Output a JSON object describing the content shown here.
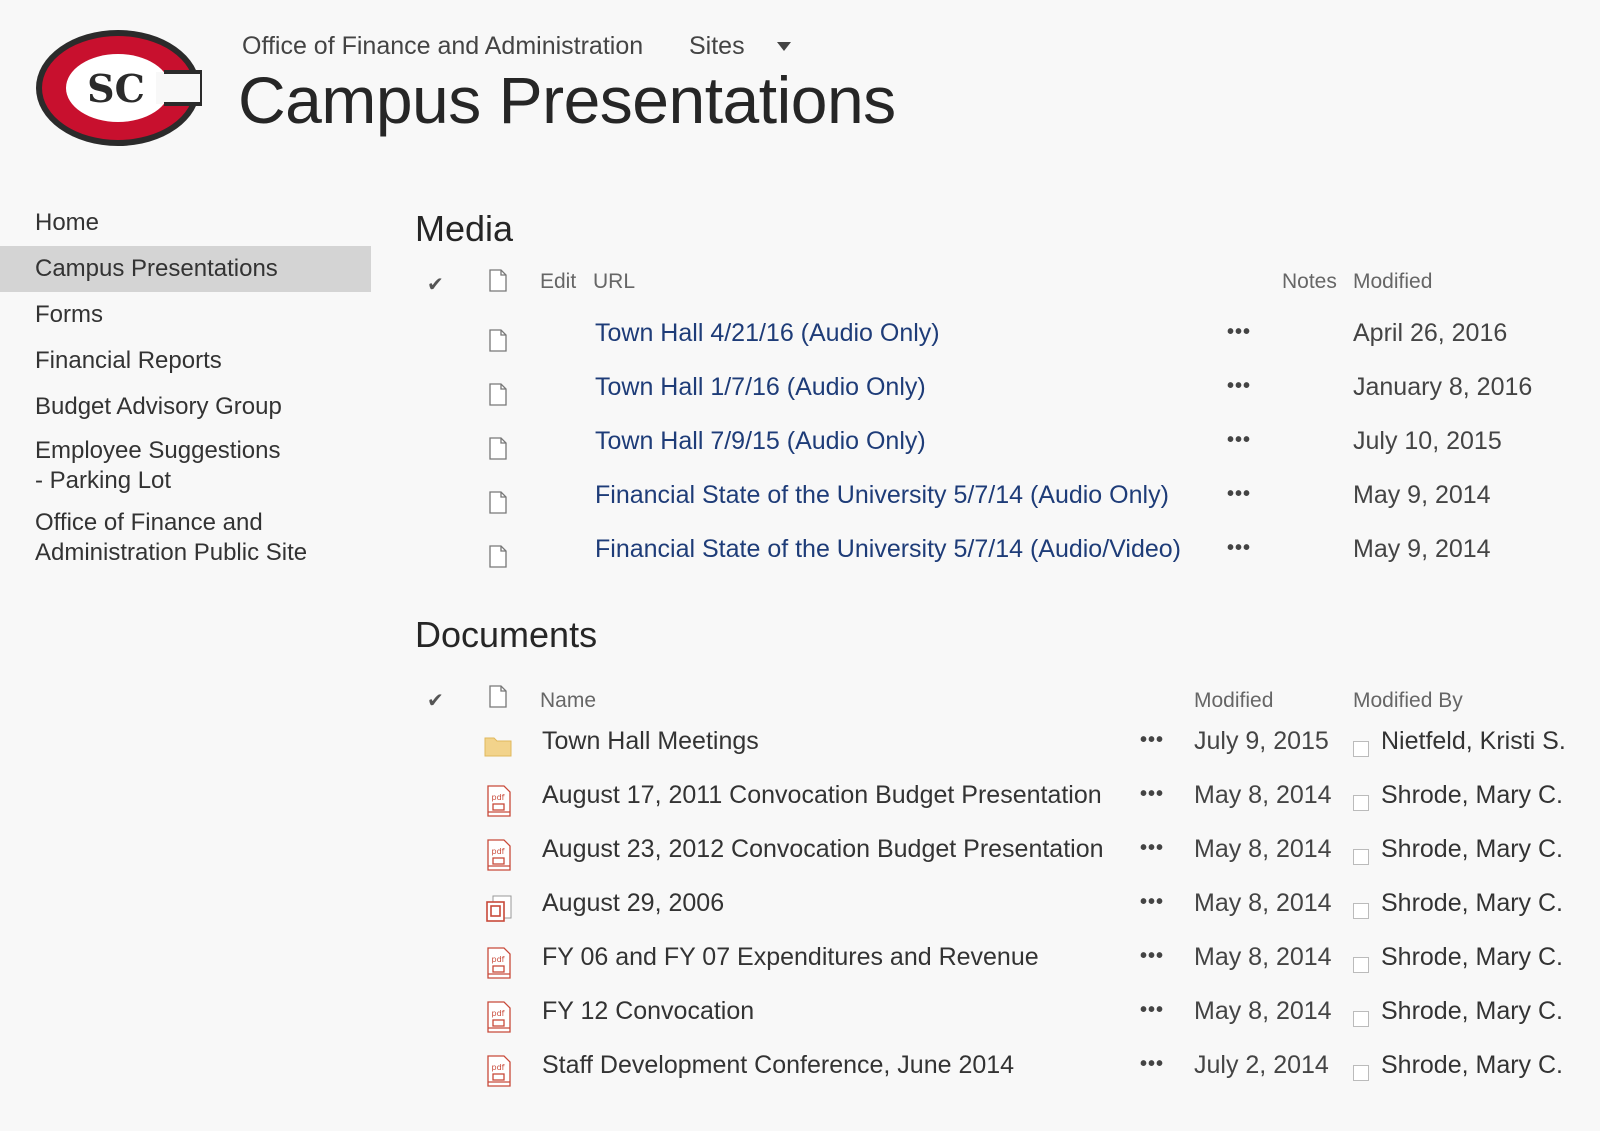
{
  "header": {
    "parent_site": "Office of Finance and Administration",
    "sites_label": "Sites",
    "site_title": "Campus Presentations",
    "logo_text": "SC"
  },
  "nav": {
    "items": [
      {
        "label": "Home"
      },
      {
        "label": "Campus Presentations"
      },
      {
        "label": "Forms"
      },
      {
        "label": "Financial Reports"
      },
      {
        "label": "Budget Advisory Group"
      },
      {
        "label": "Employee Suggestions - Parking Lot"
      },
      {
        "label": "Office of Finance and Administration Public Site"
      }
    ]
  },
  "media": {
    "title": "Media",
    "columns": {
      "edit": "Edit",
      "url": "URL",
      "notes": "Notes",
      "modified": "Modified"
    },
    "rows": [
      {
        "url": "Town Hall 4/21/16 (Audio Only)",
        "modified": "April 26, 2016"
      },
      {
        "url": "Town Hall 1/7/16 (Audio Only)",
        "modified": "January 8, 2016"
      },
      {
        "url": "Town Hall 7/9/15 (Audio Only)",
        "modified": "July 10, 2015"
      },
      {
        "url": "Financial State of the University 5/7/14 (Audio Only)",
        "modified": "May 9, 2014"
      },
      {
        "url": "Financial State of the University 5/7/14 (Audio/Video)",
        "modified": "May 9, 2014"
      }
    ]
  },
  "documents": {
    "title": "Documents",
    "columns": {
      "name": "Name",
      "modified": "Modified",
      "modified_by": "Modified By"
    },
    "rows": [
      {
        "icon": "folder-icon",
        "name": "Town Hall Meetings",
        "modified": "July 9, 2015",
        "modified_by": "Nietfeld, Kristi S."
      },
      {
        "icon": "pdf-icon",
        "name": "August 17, 2011 Convocation Budget Presentation",
        "modified": "May 8, 2014",
        "modified_by": "Shrode, Mary C."
      },
      {
        "icon": "pdf-icon",
        "name": "August 23, 2012 Convocation Budget Presentation",
        "modified": "May 8, 2014",
        "modified_by": "Shrode, Mary C."
      },
      {
        "icon": "powerpoint-icon",
        "name": "August 29, 2006",
        "modified": "May 8, 2014",
        "modified_by": "Shrode, Mary C."
      },
      {
        "icon": "pdf-icon",
        "name": "FY 06 and FY 07 Expenditures and Revenue",
        "modified": "May 8, 2014",
        "modified_by": "Shrode, Mary C."
      },
      {
        "icon": "pdf-icon",
        "name": "FY 12 Convocation",
        "modified": "May 8, 2014",
        "modified_by": "Shrode, Mary C."
      },
      {
        "icon": "pdf-icon",
        "name": "Staff Development Conference, June 2014",
        "modified": "July 2, 2014",
        "modified_by": "Shrode, Mary C."
      }
    ]
  },
  "ellipsis": "•••",
  "check_mark": "✔",
  "colors": {
    "link": "#1e3c78",
    "logo_red": "#c8102e",
    "selected_nav": "#d4d4d4",
    "folder": "#f2d38b",
    "pdf_red": "#c84a3a"
  }
}
